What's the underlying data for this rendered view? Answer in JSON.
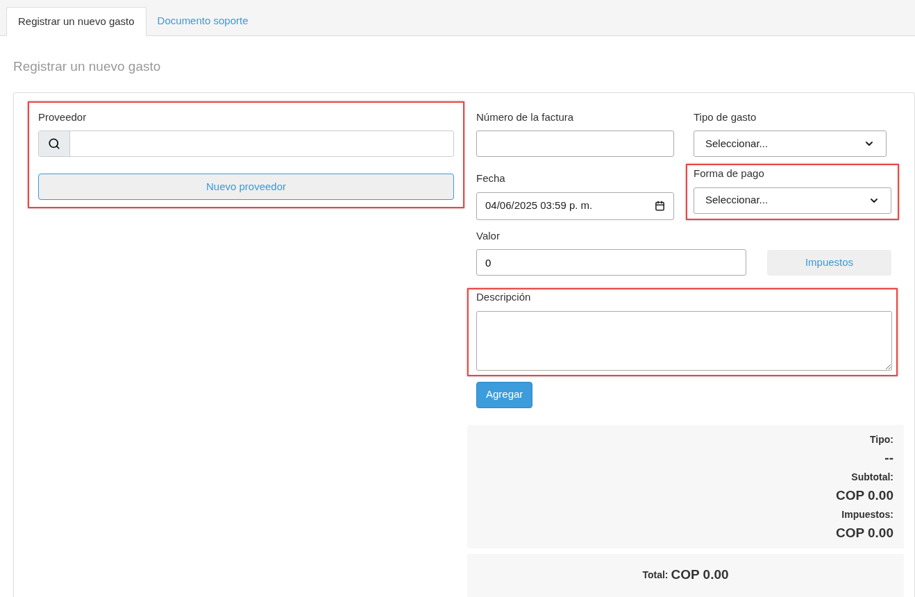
{
  "tabs": [
    {
      "label": "Registrar un nuevo gasto",
      "selected": true
    },
    {
      "label": "Documento soporte",
      "selected": false
    }
  ],
  "heading": "Registrar un nuevo gasto",
  "supplier": {
    "label": "Proveedor",
    "new_button": "Nuevo proveedor",
    "highlighted": true
  },
  "invoice_number": {
    "label": "Número de la factura"
  },
  "expense_type": {
    "label": "Tipo de gasto",
    "value": "Seleccionar...",
    "highlighted": false
  },
  "date": {
    "label": "Fecha",
    "value": "04/06/2025 03:59 p. m."
  },
  "payment_method": {
    "label": "Forma de pago",
    "value": "Seleccionar...",
    "highlighted": true
  },
  "amount": {
    "label": "Valor",
    "value": "0",
    "taxes_button": "Impuestos"
  },
  "description": {
    "label": "Descripción",
    "highlighted": true
  },
  "add_button": "Agregar",
  "summary": [
    {
      "label": "Tipo:",
      "value": "--"
    },
    {
      "label": "Subtotal:",
      "value": "COP 0.00"
    },
    {
      "label": "Impuestos:",
      "value": "COP 0.00"
    }
  ],
  "total": {
    "label": "Total:",
    "value": "COP 0.00"
  }
}
